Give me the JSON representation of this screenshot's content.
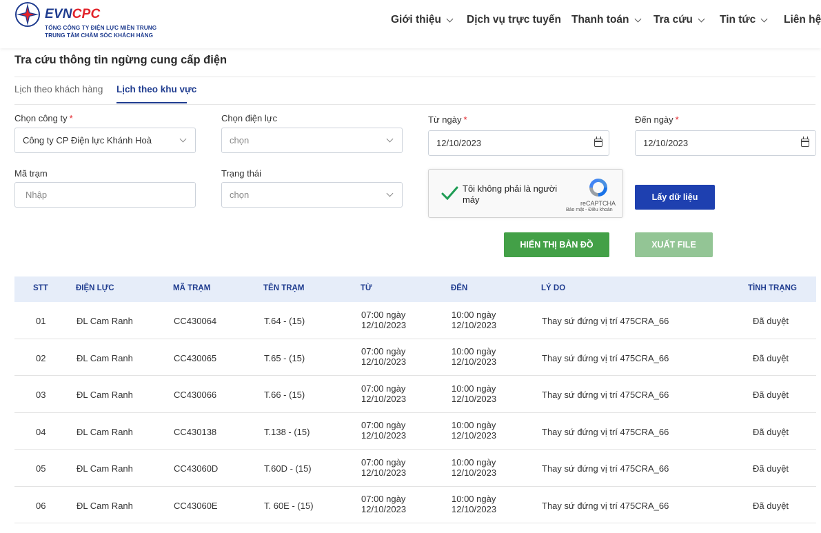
{
  "brand": {
    "name_part1": "EVN",
    "name_part2": "CPC",
    "subtitle_line1": "TỔNG CÔNG TY ĐIỆN LỰC MIỀN TRUNG",
    "subtitle_line2": "TRUNG TÂM CHĂM SÓC KHÁCH HÀNG"
  },
  "nav": {
    "items": [
      {
        "label": "Giới thiệu",
        "has_dropdown": true
      },
      {
        "label": "Dịch vụ trực tuyến",
        "has_dropdown": false
      },
      {
        "label": "Thanh toán",
        "has_dropdown": true
      },
      {
        "label": "Tra cứu",
        "has_dropdown": true
      },
      {
        "label": "Tin tức",
        "has_dropdown": true
      },
      {
        "label": "Liên hệ",
        "has_dropdown": false
      }
    ]
  },
  "page": {
    "title": "Tra cứu thông tin ngừng cung cấp điện"
  },
  "tabs": [
    {
      "label": "Lịch theo khách hàng",
      "active": false
    },
    {
      "label": "Lịch theo khu vực",
      "active": true
    }
  ],
  "form": {
    "company": {
      "label": "Chọn công ty",
      "value": "Công ty CP Điện lực Khánh Hoà"
    },
    "power_unit": {
      "label": "Chọn điện lực",
      "placeholder": "chọn"
    },
    "from_date": {
      "label": "Từ ngày",
      "value": "12/10/2023"
    },
    "to_date": {
      "label": "Đến ngày",
      "value": "12/10/2023"
    },
    "station_code": {
      "label": "Mã trạm",
      "placeholder": "Nhập"
    },
    "status": {
      "label": "Trạng thái",
      "placeholder": "chọn"
    },
    "required_mark": "*"
  },
  "captcha": {
    "text": "Tôi không phải là người máy",
    "brand": "reCAPTCHA",
    "links": "Bảo mật - Điều khoản"
  },
  "buttons": {
    "fetch": "Lấy dữ liệu",
    "show_map": "HIỂN THỊ BẢN ĐỒ",
    "export": "XUẤT FILE"
  },
  "table": {
    "columns": [
      "STT",
      "ĐIỆN LỰC",
      "MÃ TRẠM",
      "TÊN TRẠM",
      "TỪ",
      "ĐẾN",
      "LÝ DO",
      "TÌNH TRẠNG"
    ],
    "rows": [
      {
        "stt": "01",
        "unit": "ĐL Cam Ranh",
        "code": "CC430064",
        "name": "T.64 - (15)",
        "from_time": "07:00 ngày",
        "from_date": "12/10/2023",
        "to_time": "10:00 ngày",
        "to_date": "12/10/2023",
        "reason": "Thay sứ đứng vị trí 475CRA_66",
        "status": "Đã duyệt"
      },
      {
        "stt": "02",
        "unit": "ĐL Cam Ranh",
        "code": "CC430065",
        "name": "T.65 - (15)",
        "from_time": "07:00 ngày",
        "from_date": "12/10/2023",
        "to_time": "10:00 ngày",
        "to_date": "12/10/2023",
        "reason": "Thay sứ đứng vị trí 475CRA_66",
        "status": "Đã duyệt"
      },
      {
        "stt": "03",
        "unit": "ĐL Cam Ranh",
        "code": "CC430066",
        "name": "T.66 - (15)",
        "from_time": "07:00 ngày",
        "from_date": "12/10/2023",
        "to_time": "10:00 ngày",
        "to_date": "12/10/2023",
        "reason": "Thay sứ đứng vị trí 475CRA_66",
        "status": "Đã duyệt"
      },
      {
        "stt": "04",
        "unit": "ĐL Cam Ranh",
        "code": "CC430138",
        "name": "T.138 - (15)",
        "from_time": "07:00 ngày",
        "from_date": "12/10/2023",
        "to_time": "10:00 ngày",
        "to_date": "12/10/2023",
        "reason": "Thay sứ đứng vị trí 475CRA_66",
        "status": "Đã duyệt"
      },
      {
        "stt": "05",
        "unit": "ĐL Cam Ranh",
        "code": "CC43060D",
        "name": "T.60D - (15)",
        "from_time": "07:00 ngày",
        "from_date": "12/10/2023",
        "to_time": "10:00 ngày",
        "to_date": "12/10/2023",
        "reason": "Thay sứ đứng vị trí 475CRA_66",
        "status": "Đã duyệt"
      },
      {
        "stt": "06",
        "unit": "ĐL Cam Ranh",
        "code": "CC43060E",
        "name": "T. 60E - (15)",
        "from_time": "07:00 ngày",
        "from_date": "12/10/2023",
        "to_time": "10:00 ngày",
        "to_date": "12/10/2023",
        "reason": "Thay sứ đứng vị trí 475CRA_66",
        "status": "Đã duyệt"
      }
    ]
  },
  "colors": {
    "brand_blue": "#1f3c8f",
    "brand_red": "#e2232a",
    "primary_button": "#1e40b0",
    "map_button": "#43a047",
    "export_button_disabled": "#93c595",
    "table_header_bg": "#e6edf9"
  },
  "icons": {
    "logo": "evn-star-logo-icon",
    "dropdown": "chevron-down-icon",
    "date": "calendar-icon",
    "captcha_check": "checkmark-icon",
    "captcha_logo": "recaptcha-icon"
  }
}
